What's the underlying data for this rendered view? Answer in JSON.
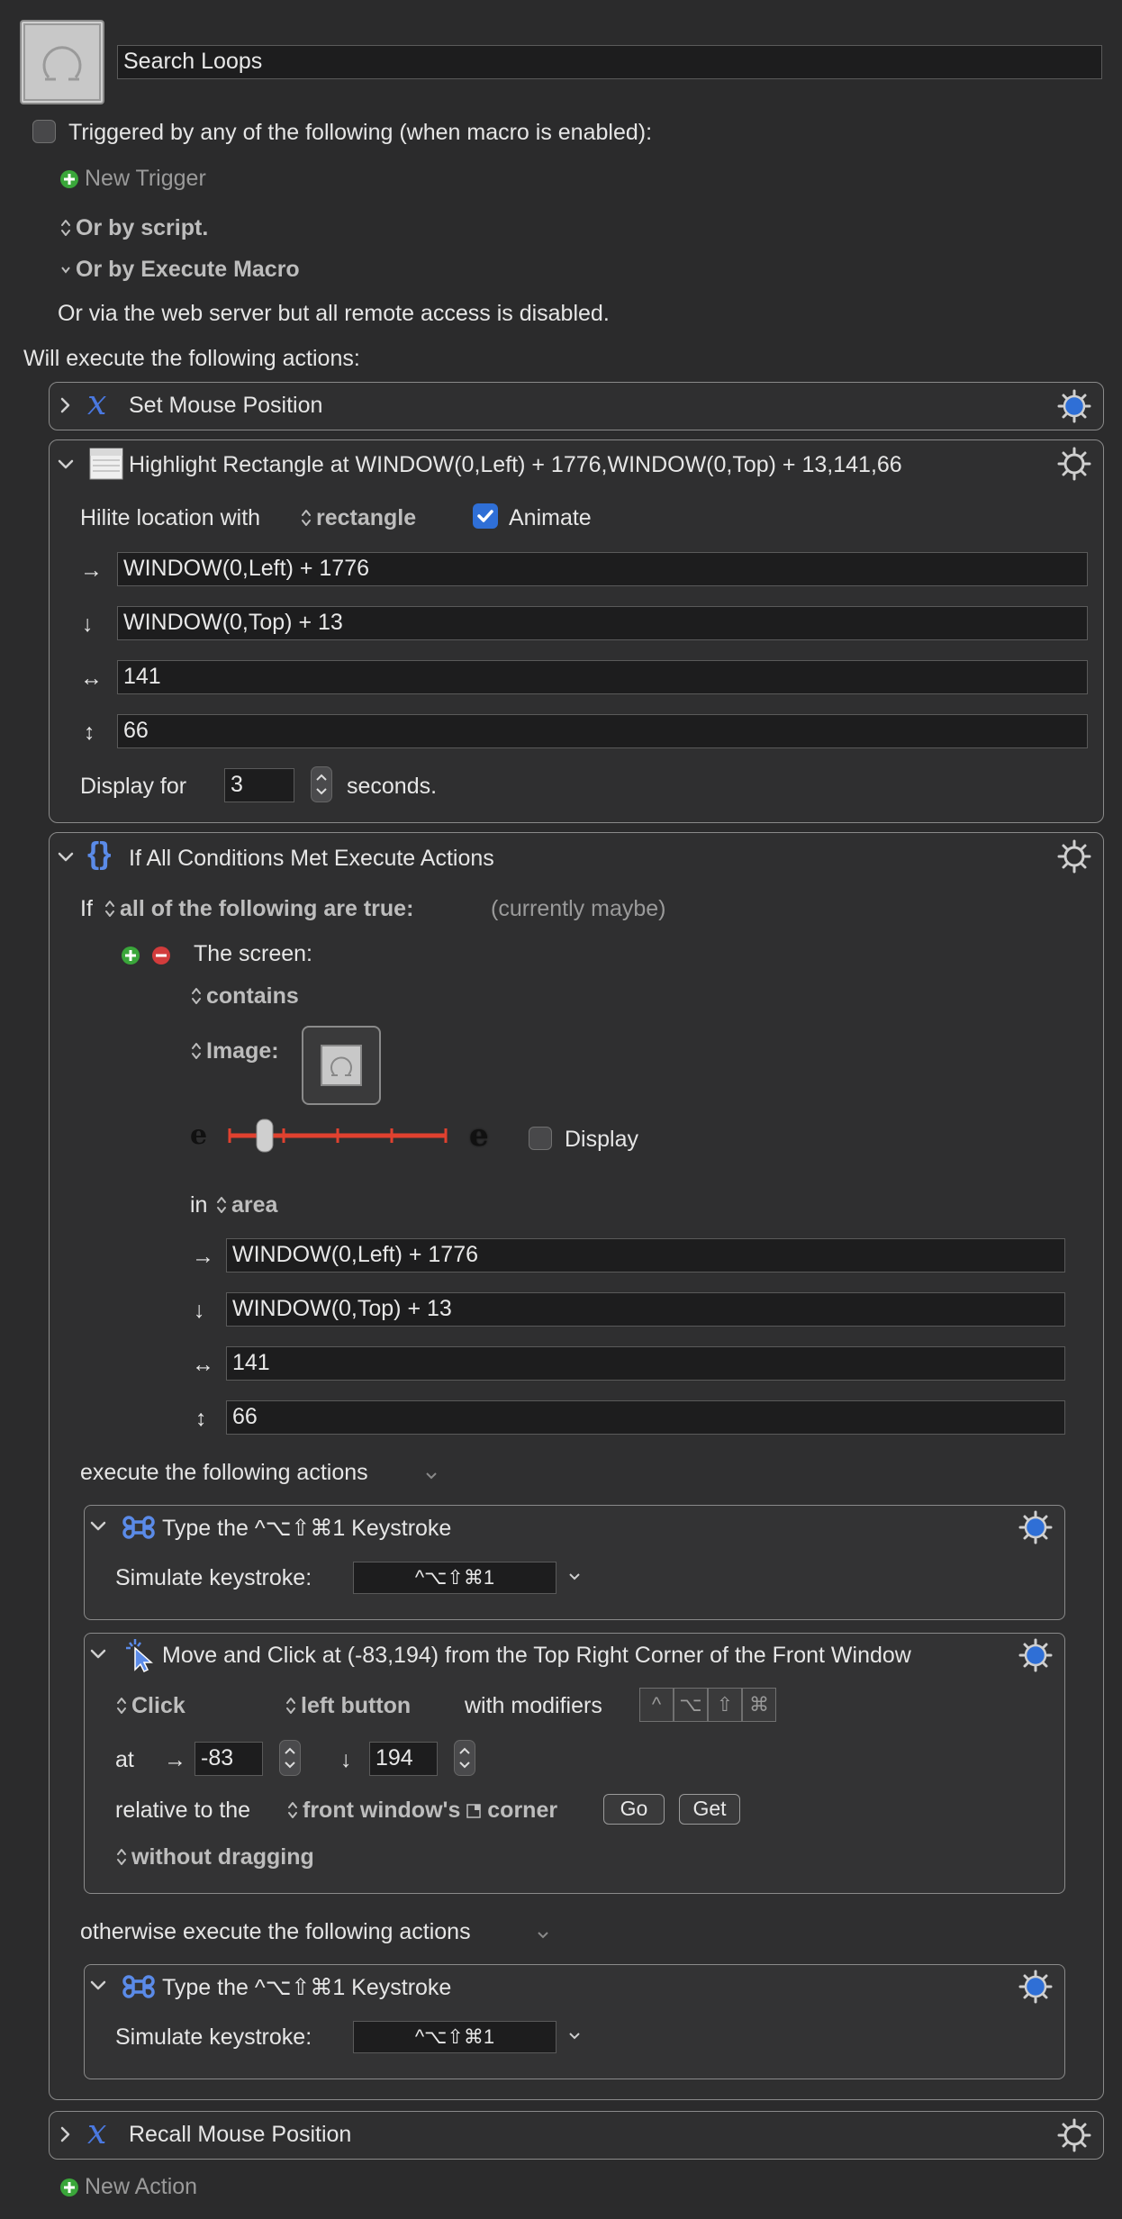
{
  "macro": {
    "name": "Search Loops",
    "trigger_header": "Triggered by any of the following (when macro is enabled):",
    "new_trigger": "New Trigger",
    "or_by_script": "Or by script.",
    "or_by_execute_macro": "Or by Execute Macro",
    "web_server_note": "Or via the web server but all remote access is disabled.",
    "will_execute": "Will execute the following actions:",
    "new_action": "New Action"
  },
  "actions": {
    "set_mouse": {
      "title": "Set Mouse Position"
    },
    "highlight": {
      "title": "Highlight Rectangle at WINDOW(0,Left) + 1776,WINDOW(0,Top) + 13,141,66",
      "hilite_label": "Hilite location with",
      "hilite_mode": "rectangle",
      "animate_label": "Animate",
      "animate_checked": true,
      "x": "WINDOW(0,Left) + 1776",
      "y": "WINDOW(0,Top) + 13",
      "width": "141",
      "height": "66",
      "display_for_label": "Display for",
      "display_for_value": "3",
      "seconds_label": "seconds."
    },
    "if_action": {
      "title": "If All Conditions Met Execute Actions",
      "if_label": "If",
      "condition_mode": "all of the following are true:",
      "status": "(currently maybe)",
      "screen_label": "The screen:",
      "contains": "contains",
      "image_label": "Image:",
      "display_label": "Display",
      "in_label": "in",
      "area": "area",
      "x": "WINDOW(0,Left) + 1776",
      "y": "WINDOW(0,Top) + 13",
      "width": "141",
      "height": "66",
      "execute_label": "execute the following actions",
      "otherwise_label": "otherwise execute the following actions"
    },
    "type1": {
      "title": "Type the ^⌥⇧⌘1 Keystroke",
      "simulate_label": "Simulate keystroke:",
      "keystroke": "^⌥⇧⌘1"
    },
    "move_click": {
      "title": "Move and Click at (-83,194) from the Top Right Corner of the Front Window",
      "click": "Click",
      "button": "left button",
      "with_modifiers": "with modifiers",
      "modifiers": [
        "^",
        "⌥",
        "⇧",
        "⌘"
      ],
      "at_label": "at",
      "x_value": "-83",
      "y_value": "194",
      "relative_label": "relative to the",
      "relative_target": "front window's",
      "corner_label": "corner",
      "go_button": "Go",
      "get_button": "Get",
      "dragging": "without dragging"
    },
    "type2": {
      "title": "Type the ^⌥⇧⌘1 Keystroke",
      "simulate_label": "Simulate keystroke:",
      "keystroke": "^⌥⇧⌘1"
    },
    "recall_mouse": {
      "title": "Recall Mouse Position"
    }
  },
  "arrows": {
    "right": "→",
    "down": "↓",
    "horiz": "↔",
    "vert": "↕"
  },
  "colors": {
    "accent": "#2f6fd6",
    "add": "#3aa63a",
    "remove": "#d23c3c",
    "slider": "#e0412f"
  }
}
